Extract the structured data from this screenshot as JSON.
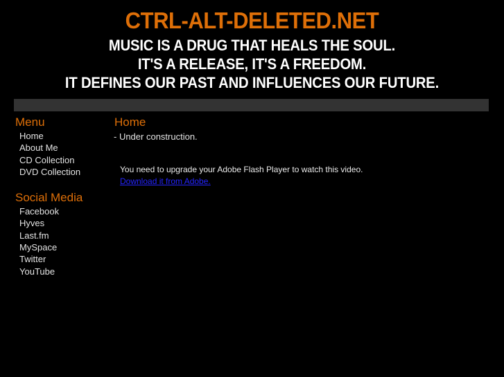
{
  "site": {
    "title": "CTRL-ALT-DELETED.NET",
    "taglines": [
      "MUSIC IS A DRUG THAT HEALS THE SOUL.",
      "IT'S A RELEASE, IT'S A FREEDOM.",
      "IT DEFINES OUR PAST AND INFLUENCES OUR FUTURE."
    ]
  },
  "colors": {
    "background": "#000000",
    "accent_orange": "#de6f08",
    "body_text": "#e4e4e4",
    "bar_gray": "#333333",
    "link_blue": "#2424ff"
  },
  "topbar": {
    "label": ""
  },
  "sidebar": {
    "menu": {
      "heading": "Menu",
      "items": [
        {
          "label": "Home"
        },
        {
          "label": "About Me"
        },
        {
          "label": "CD Collection"
        },
        {
          "label": "DVD Collection"
        }
      ]
    },
    "social": {
      "heading": "Social Media",
      "items": [
        {
          "label": "Facebook"
        },
        {
          "label": "Hyves"
        },
        {
          "label": "Last.fm"
        },
        {
          "label": "MySpace"
        },
        {
          "label": "Twitter"
        },
        {
          "label": "YouTube"
        }
      ]
    }
  },
  "main": {
    "title": "Home",
    "subtitle": "- Under construction.",
    "flash": {
      "message": "You need to upgrade your Adobe Flash Player to watch this video.",
      "link_label": "Download it from Adobe."
    }
  }
}
